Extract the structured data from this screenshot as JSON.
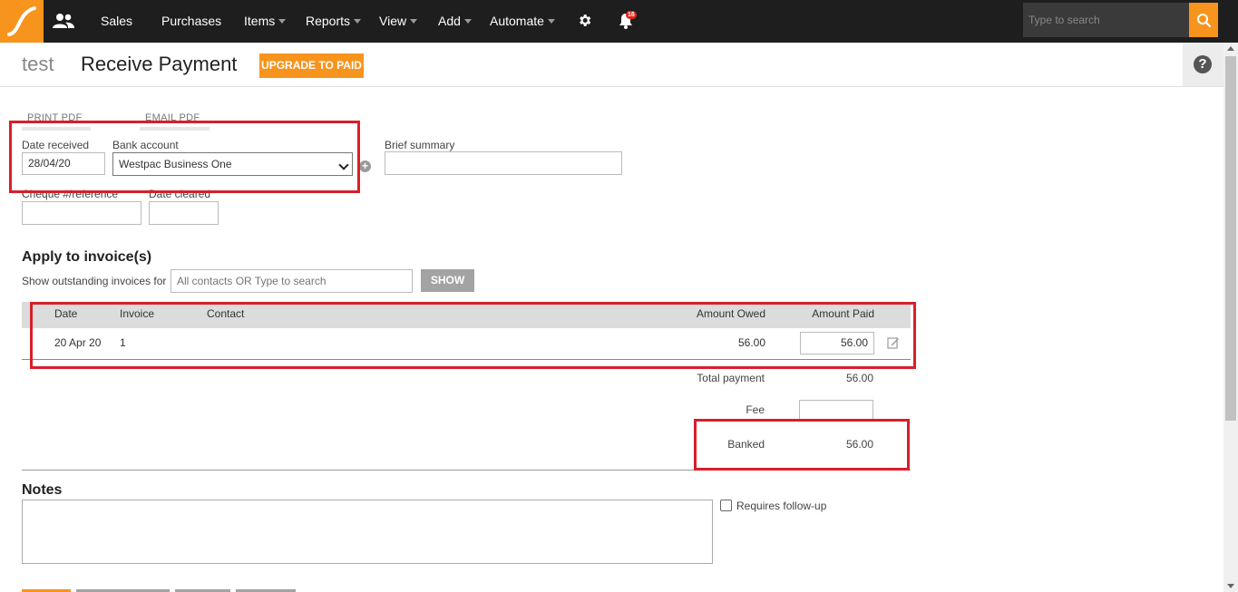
{
  "topbar": {
    "nav": [
      {
        "label": "Sales"
      },
      {
        "label": "Purchases"
      },
      {
        "label": "Items"
      },
      {
        "label": "Reports"
      },
      {
        "label": "View"
      },
      {
        "label": "Add"
      },
      {
        "label": "Automate"
      }
    ],
    "notification_count": "16",
    "search_placeholder": "Type to search"
  },
  "header": {
    "org_name": "test",
    "page_title": "Receive Payment",
    "upgrade_label": "UPGRADE TO PAID"
  },
  "form": {
    "print_pdf": "PRINT PDF",
    "email_pdf": "EMAIL PDF",
    "date_received_label": "Date received",
    "date_received_value": "28/04/20",
    "bank_account_label": "Bank account",
    "bank_account_value": "Westpac Business One",
    "brief_summary_label": "Brief summary",
    "cheque_label": "Cheque #/reference",
    "date_cleared_label": "Date cleared"
  },
  "apply": {
    "title": "Apply to invoice(s)",
    "show_label": "Show outstanding invoices for",
    "contacts_placeholder": "All contacts OR Type to search",
    "show_button": "SHOW",
    "columns": {
      "date": "Date",
      "invoice": "Invoice",
      "contact": "Contact",
      "amount_owed": "Amount Owed",
      "amount_paid": "Amount Paid"
    },
    "rows": [
      {
        "date": "20 Apr 20",
        "invoice": "1",
        "contact": "",
        "amount_owed": "56.00",
        "amount_paid": "56.00"
      }
    ],
    "total_payment_label": "Total payment",
    "total_payment_value": "56.00",
    "fee_label": "Fee",
    "banked_label": "Banked",
    "banked_value": "56.00"
  },
  "notes": {
    "title": "Notes",
    "follow_up_label": "Requires follow-up"
  },
  "colors": {
    "accent": "#f7941d",
    "topbar": "#1e1e1e",
    "annotation_red": "#d81e2a"
  }
}
